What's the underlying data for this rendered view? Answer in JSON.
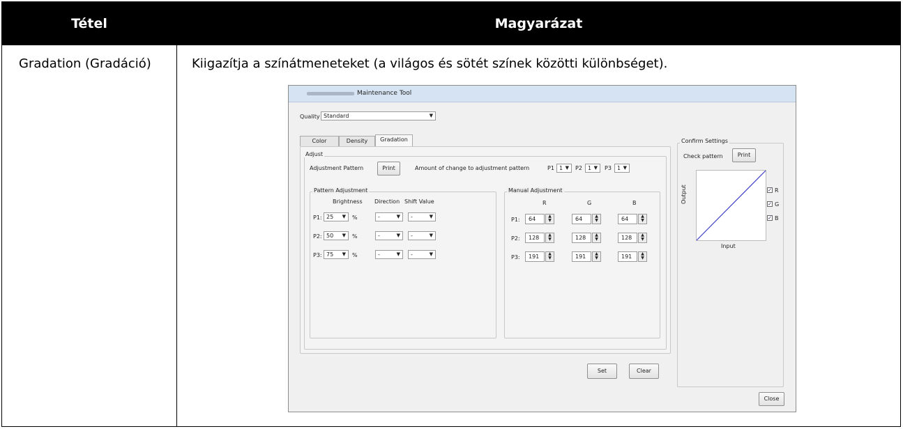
{
  "table": {
    "header": {
      "col1": "Tétel",
      "col2": "Magyarázat"
    },
    "row": {
      "item": "Gradation (Gradáció)",
      "description": "Kiigazítja a színátmeneteket (a világos és sötét színek közötti különbséget)."
    }
  },
  "app": {
    "title": "Maintenance Tool",
    "quality_label": "Quality",
    "quality_value": "Standard",
    "tabs": [
      "Color Balance",
      "Density",
      "Gradation"
    ],
    "active_tab": "Gradation",
    "adjust": {
      "group_label": "Adjust",
      "pattern_label": "Adjustment Pattern",
      "print_label": "Print",
      "amount_label": "Amount of change to adjustment pattern",
      "p1_label": "P1",
      "p1_value": "1",
      "p2_label": "P2",
      "p2_value": "1",
      "p3_label": "P3",
      "p3_value": "1"
    },
    "pattern_adjustment": {
      "group_label": "Pattern Adjustment",
      "col_brightness": "Brightness",
      "col_direction": "Direction",
      "col_shift": "Shift Value",
      "percent": "%",
      "rows": [
        {
          "label": "P1:",
          "brightness": "25",
          "direction": "-",
          "shift": "-"
        },
        {
          "label": "P2:",
          "brightness": "50",
          "direction": "-",
          "shift": "-"
        },
        {
          "label": "P3:",
          "brightness": "75",
          "direction": "-",
          "shift": "-"
        }
      ]
    },
    "manual_adjustment": {
      "group_label": "Manual Adjustment",
      "col_r": "R",
      "col_g": "G",
      "col_b": "B",
      "rows": [
        {
          "label": "P1:",
          "r": "64",
          "g": "64",
          "b": "64"
        },
        {
          "label": "P2:",
          "r": "128",
          "g": "128",
          "b": "128"
        },
        {
          "label": "P3:",
          "r": "191",
          "g": "191",
          "b": "191"
        }
      ]
    },
    "confirm": {
      "group_label": "Confirm Settings",
      "check_label": "Check pattern",
      "print_label": "Print",
      "y_axis": "Output",
      "x_axis": "Input",
      "cb_r": "R",
      "cb_g": "G",
      "cb_b": "B",
      "line_color": "#3a3ac8"
    },
    "buttons": {
      "set": "Set",
      "clear": "Clear",
      "close": "Close"
    }
  }
}
